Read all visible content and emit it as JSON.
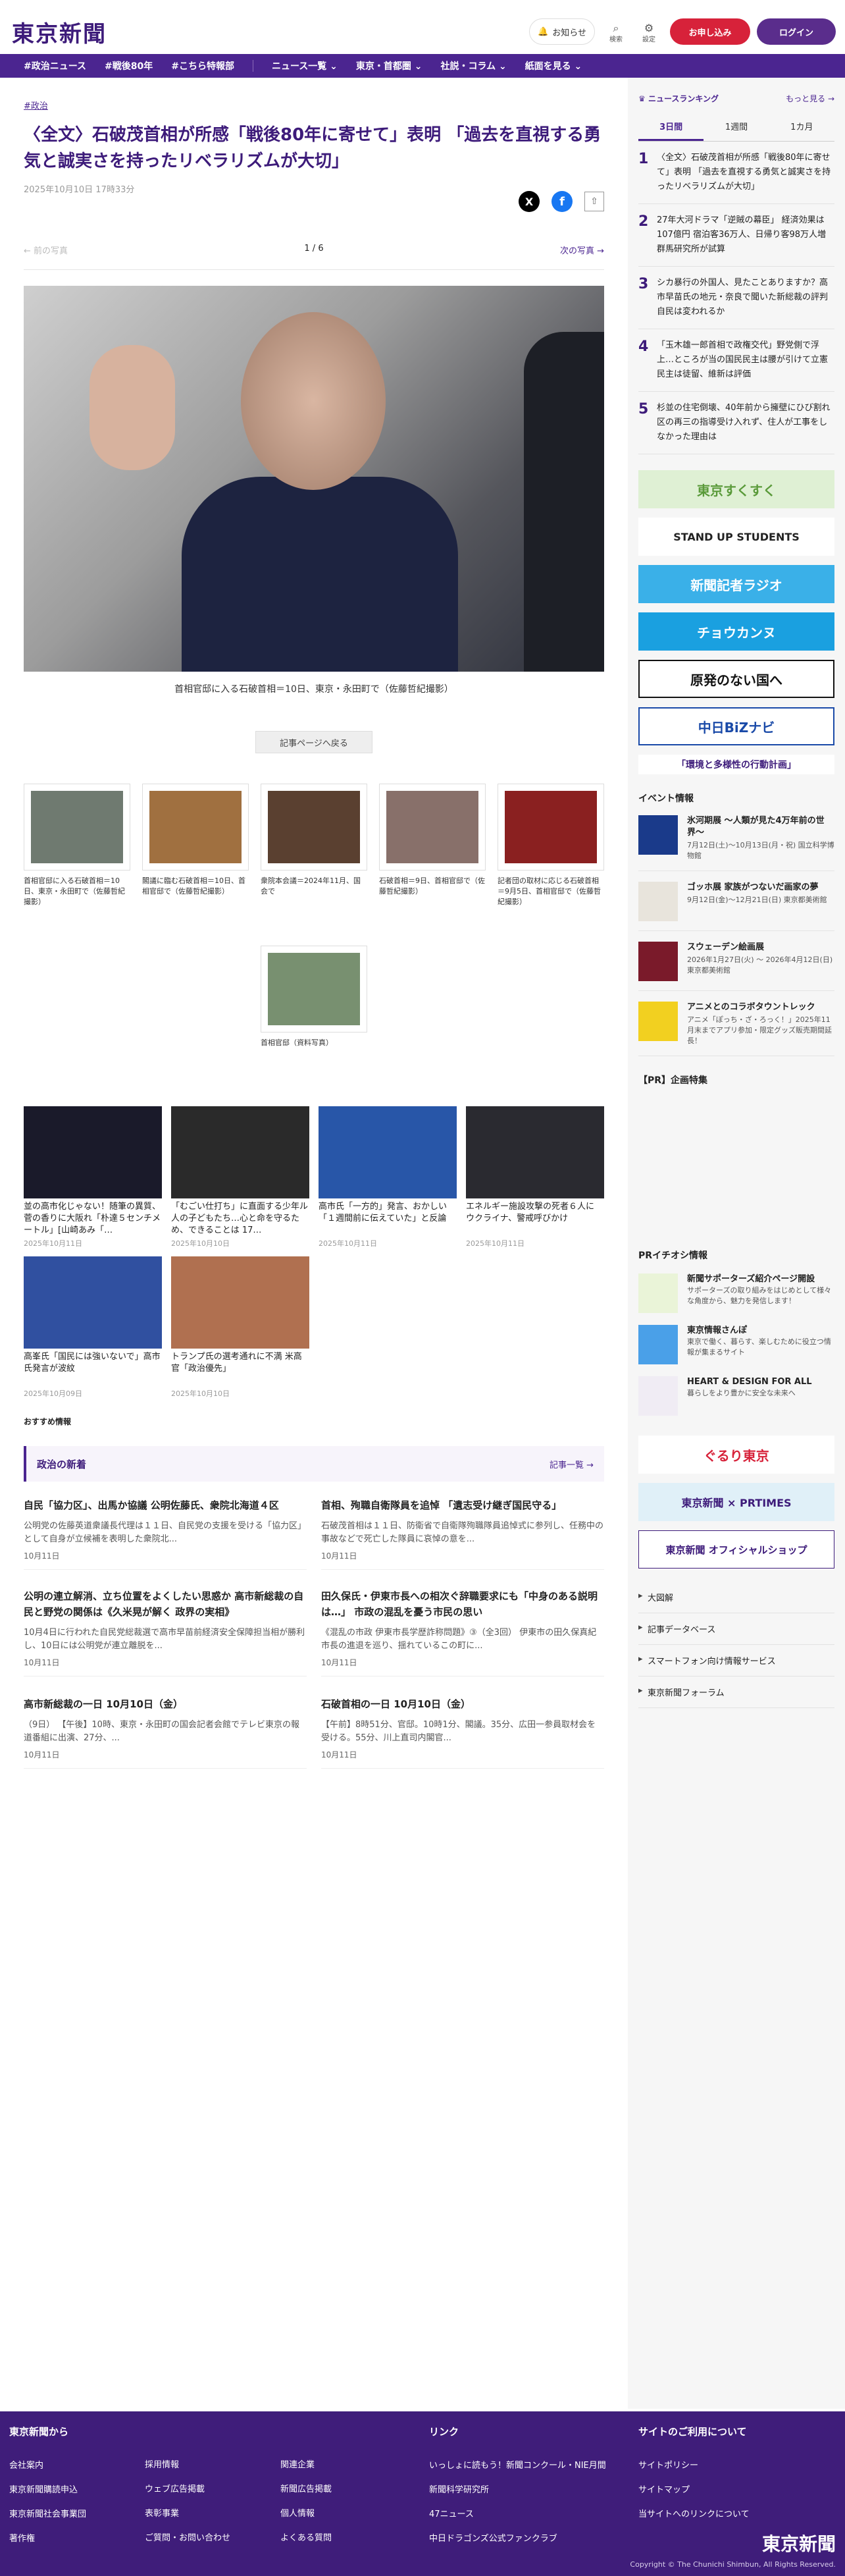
{
  "header": {
    "logo": "東京新聞",
    "notice": "お知らせ",
    "search": "検索",
    "settings": "設定",
    "subscribe": "お申し込み",
    "login": "ログイン"
  },
  "nav": [
    "#政治ニュース",
    "#戦後80年",
    "#こちら特報部",
    "ニュース一覧 ⌄",
    "東京・首都圏 ⌄",
    "社説・コラム ⌄",
    "紙面を見る ⌄"
  ],
  "article": {
    "category": "#政治",
    "title": "〈全文〉石破茂首相が所感「戦後80年に寄せて」表明 「過去を直視する勇気と誠実さを持ったリベラリズムが大切」",
    "date": "2025年10月10日 17時33分",
    "share": {
      "x": "X",
      "facebook": "f",
      "save": "⇧"
    },
    "pager": {
      "prev": "← 前の写真",
      "count": "1 / 6",
      "next": "次の写真 →"
    },
    "caption": "首相官邸に入る石破首相＝10日、東京・永田町で（佐藤哲紀撮影）",
    "back": "記事ページへ戻る",
    "thumbs": [
      {
        "cap": "首相官邸に入る石破首相＝10日、東京・永田町で（佐藤哲紀撮影）",
        "c": "#6f7a70"
      },
      {
        "cap": "閣議に臨む石破首相＝10日、首相官邸で（佐藤哲紀撮影）",
        "c": "#a07040"
      },
      {
        "cap": "衆院本会議＝2024年11月、国会で",
        "c": "#5a4030"
      },
      {
        "cap": "石破首相＝9日、首相官邸で（佐藤哲紀撮影）",
        "c": "#88706a"
      },
      {
        "cap": "記者団の取材に応じる石破首相＝9月5日、首相官邸で（佐藤哲紀撮影）",
        "c": "#8a2020"
      },
      {
        "cap": "首相官邸（資料写真）",
        "c": "#789070"
      }
    ]
  },
  "related": [
    {
      "t": "並の高市化じゃない！随筆の異質、菅の香りに大阪れ「朴達５センチメートル」[山崎あみ「…",
      "d": "2025年10月11日",
      "c": "#1a1a2a"
    },
    {
      "t": "「むごい仕打ち」に直面する少年ル人の子どもたち…心と命を守るため、できることは 17…",
      "d": "2025年10月10日",
      "c": "#2a2a2a"
    },
    {
      "t": "高市氏「一方的」発言、おかしい「１週間前に伝えていた」と反論",
      "d": "2025年10月11日",
      "c": "#2856a8"
    },
    {
      "t": "エネルギー施設攻撃の死者６人に ウクライナ、警戒呼びかけ",
      "d": "2025年10月11日",
      "c": "#2a2a30"
    },
    {
      "t": "高峯氏「国民には強いないで」高市氏発言が波紋",
      "d": "2025年10月09日",
      "c": "#3050a0"
    },
    {
      "t": "トランプ氏の選考通れに不満 米高官「政治優先」",
      "d": "2025年10月10日",
      "c": "#b07050"
    }
  ],
  "reco": "おすすめ情報",
  "news": {
    "title": "政治の新着",
    "more": "記事一覧 →",
    "items": [
      {
        "t": "自民「協力区」、出馬か協議 公明佐藤氏、衆院北海道４区",
        "p": "公明党の佐藤英道衆議長代理は１１日、自民党の支援を受ける「協力区」として自身が立候補を表明した衆院北...",
        "d": "10月11日"
      },
      {
        "t": "首相、殉職自衛隊員を追悼 「遺志受け継ぎ国民守る」",
        "p": "石破茂首相は１１日、防衛省で自衛隊殉職隊員追悼式に参列し、任務中の事故などで死亡した隊員に哀悼の意を...",
        "d": "10月11日"
      },
      {
        "t": "公明の連立解消、立ち位置をよくしたい思惑か 高市新総裁の自民と野党の関係は《久米晃が解く 政界の実相》",
        "p": "10月4日に行われた自民党総裁選で高市早苗前経済安全保障担当相が勝利し、10日には公明党が連立離脱を...",
        "d": "10月11日"
      },
      {
        "t": "田久保氏・伊東市長への相次ぐ辞職要求にも「中身のある説明は…」 市政の混乱を憂う市民の思い",
        "p": "《混乱の市政 伊東市長学歴詐称問題》③（全3回） 伊東市の田久保真紀市長の進退を巡り、揺れているこの町に...",
        "d": "10月11日"
      },
      {
        "t": "高市新総裁の一日 10月10日（金）",
        "p": "（9日） 【午後】10時、東京・永田町の国会記者会館でテレビ東京の報道番組に出演、27分、...",
        "d": "10月11日"
      },
      {
        "t": "石破首相の一日 10月10日（金）",
        "p": "【午前】8時51分、官邸。10時1分、閣議。35分、広田一参員取材会を受ける。55分、川上直司内閣官...",
        "d": "10月11日"
      }
    ]
  },
  "ranking": {
    "title": "ニュースランキング",
    "more": "もっと見る →",
    "tabs": [
      "3日間",
      "1週間",
      "1カ月"
    ],
    "items": [
      "〈全文〉石破茂首相が所感「戦後80年に寄せて」表明 「過去を直視する勇気と誠実さを持ったリベラリズムが大切」",
      "27年大河ドラマ「逆賊の幕臣」 経済効果は107億円 宿泊客36万人、日帰り客98万人増 群馬研究所が試算",
      "シカ暴行の外国人、見たことありますか？高市早苗氏の地元・奈良で聞いた新総裁の評判 自民は変われるか",
      "「玉木雄一郎首相で政権交代」野党側で浮上…ところが当の国民民主は腰が引けて立憲民主は徒留、維新は評価",
      "杉並の住宅倒壊、40年前から擁壁にひび割れ 区の再三の指導受け入れず、住人が工事をしなかった理由は"
    ]
  },
  "banners": [
    {
      "t": "東京すくすく",
      "bg": "#dff0d4",
      "fg": "#5a9a3a"
    },
    {
      "t": "STAND UP STUDENTS",
      "bg": "#fff",
      "fg": "#222"
    },
    {
      "t": "新聞記者ラジオ",
      "bg": "#3ab0e8",
      "fg": "#fff"
    },
    {
      "t": "チョウカンヌ",
      "bg": "#1aa0e0",
      "fg": "#fff"
    },
    {
      "t": "原発のない国へ",
      "bg": "#fff",
      "fg": "#111"
    },
    {
      "t": "中日BiZナビ",
      "bg": "#fff",
      "fg": "#1a4aa8"
    },
    {
      "t": "「環境と多様性の行動計画」",
      "bg": "#fff",
      "fg": "#3d1b7a"
    }
  ],
  "events": {
    "title": "イベント情報",
    "items": [
      {
        "t": "氷河期展 〜人類が見た4万年前の世界〜",
        "p": "7月12日(土)〜10月13日(月・祝) 国立科学博物館",
        "c": "#1a3a8a"
      },
      {
        "t": "ゴッホ展 家族がつないだ画家の夢",
        "p": "9月12日(金)〜12月21日(日) 東京都美術館",
        "c": "#e8e4dc"
      },
      {
        "t": "スウェーデン絵画展",
        "p": "2026年1月27日(火) 〜 2026年4月12日(日) 東京都美術館",
        "c": "#7a1a2a"
      },
      {
        "t": "アニメとのコラボタウントレック",
        "p": "アニメ「ぽっち・ざ・ろっく！」2025年11月末までアプリ参加・限定グッズ販売期間延長！",
        "c": "#f2d020"
      }
    ]
  },
  "pr_title": "【PR】企画特集",
  "pr_info": {
    "title": "PRイチオシ情報",
    "items": [
      {
        "t": "新聞サポーターズ紹介ページ開設",
        "p": "サポーターズの取り組みをはじめとして様々な角度から、魅力を発信します！",
        "c": "#eaf4d8"
      },
      {
        "t": "東京情報さんぽ",
        "p": "東京で働く、暮らす、楽しむために役立つ情報が集まるサイト",
        "c": "#4aa0e8"
      },
      {
        "t": "HEART & DESIGN FOR ALL",
        "p": "暮らしをより豊かに安全な未来へ",
        "c": "#f0ecf4"
      }
    ]
  },
  "banners2": [
    {
      "t": "ぐるり東京",
      "bg": "#fff",
      "fg": "#d7223a"
    },
    {
      "t": "東京新聞 × PRTIMES",
      "bg": "#e0f0f8",
      "fg": "#3d1b7a"
    },
    {
      "t": "東京新聞 オフィシャルショップ",
      "bg": "#fff",
      "fg": "#3d1b7a"
    }
  ],
  "links": [
    "大図解",
    "記事データベース",
    "スマートフォン向け情報サービス",
    "東京新聞フォーラム"
  ],
  "footer": {
    "col1": {
      "title": "東京新聞から",
      "items": [
        "会社案内",
        "東京新聞購読申込",
        "東京新聞社会事業団",
        "著作権"
      ]
    },
    "col2": {
      "items": [
        "採用情報",
        "ウェブ広告掲載",
        "表彰事業",
        "ご質問・お問い合わせ"
      ]
    },
    "col3": {
      "items": [
        "関連企業",
        "新聞広告掲載",
        "個人情報",
        "よくある質問"
      ]
    },
    "col4": {
      "title": "リンク",
      "items": [
        "いっしょに読もう！新聞コンクール・NIE月間",
        "新聞科学研究所",
        "47ニュース",
        "中日ドラゴンズ公式ファンクラブ"
      ]
    },
    "col5": {
      "title": "サイトのご利用について",
      "items": [
        "サイトポリシー",
        "サイトマップ",
        "当サイトへのリンクについて"
      ]
    },
    "logo": "東京新聞",
    "copyright": "Copyright © The Chunichi Shimbun, All Rights Reserved."
  },
  "colors": {
    "brand": "#4b2590",
    "accent": "#d7223a"
  }
}
